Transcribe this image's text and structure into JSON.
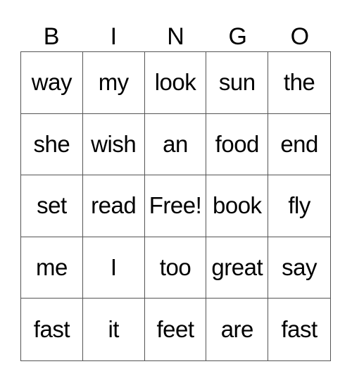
{
  "header": [
    "B",
    "I",
    "N",
    "G",
    "O"
  ],
  "cells": [
    [
      "way",
      "my",
      "look",
      "sun",
      "the"
    ],
    [
      "she",
      "wish",
      "an",
      "food",
      "end"
    ],
    [
      "set",
      "read",
      "Free!",
      "book",
      "fly"
    ],
    [
      "me",
      "I",
      "too",
      "great",
      "say"
    ],
    [
      "fast",
      "it",
      "feet",
      "are",
      "fast"
    ]
  ]
}
